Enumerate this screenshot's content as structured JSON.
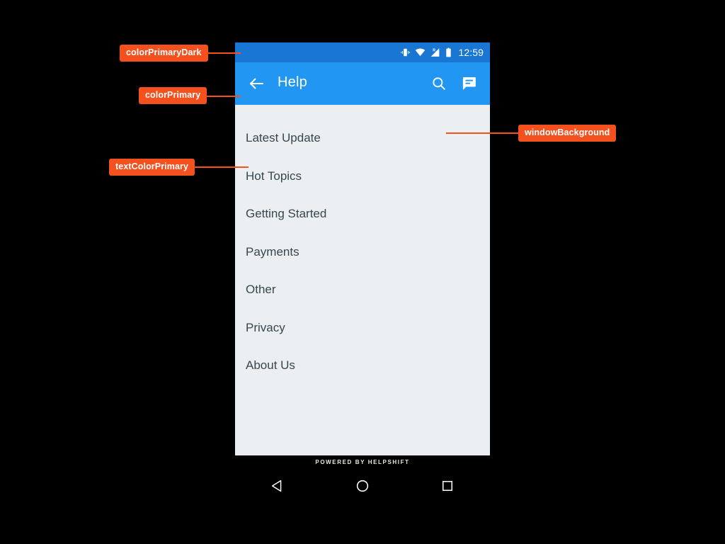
{
  "annotations": [
    {
      "id": "colorPrimaryDark",
      "label": "colorPrimaryDark"
    },
    {
      "id": "colorPrimary",
      "label": "colorPrimary"
    },
    {
      "id": "textColorPrimary",
      "label": "textColorPrimary"
    },
    {
      "id": "windowBackground",
      "label": "windowBackground"
    }
  ],
  "status_bar": {
    "time": "12:59",
    "icons": [
      "vibrate-icon",
      "wifi-icon",
      "cellular-signal-roaming-icon",
      "battery-icon"
    ],
    "roaming_label": "R",
    "background_color": "#1976D2"
  },
  "toolbar": {
    "title": "Help",
    "back_label": "Back",
    "search_label": "Search",
    "chat_label": "Start a conversation",
    "background_color": "#2196F3"
  },
  "screen": {
    "window_background_color": "#ECEFF1",
    "text_color_primary": "#37474F"
  },
  "faq_sections": [
    {
      "label": "Latest Update"
    },
    {
      "label": "Hot Topics"
    },
    {
      "label": "Getting Started"
    },
    {
      "label": "Payments"
    },
    {
      "label": "Other"
    },
    {
      "label": "Privacy"
    },
    {
      "label": "About Us"
    }
  ],
  "footer": {
    "powered_by": "POWERED BY HELPSHIFT"
  },
  "navigation_bar": {
    "back": "Back",
    "home": "Home",
    "recents": "Recent apps"
  },
  "accent_color": "#F4511E"
}
